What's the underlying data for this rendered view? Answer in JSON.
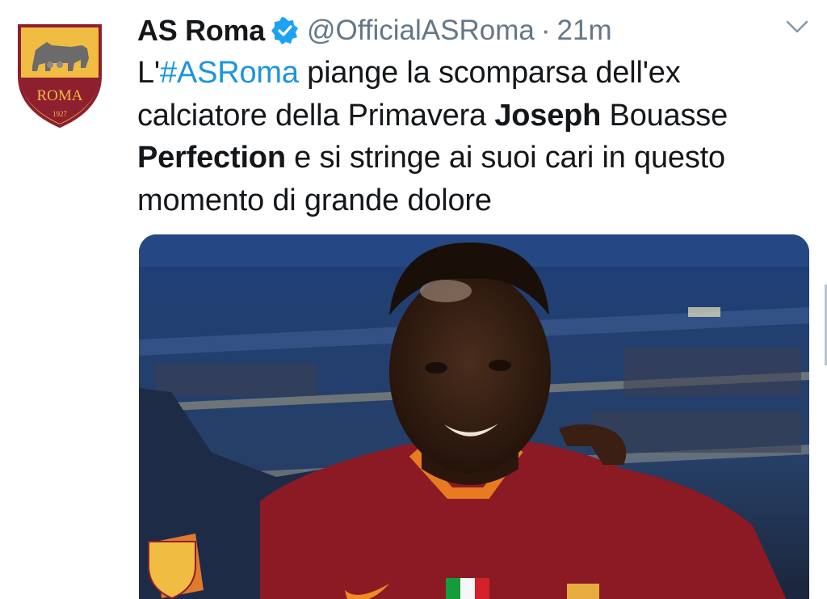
{
  "tweet": {
    "display_name": "AS Roma",
    "handle": "@OfficialASRoma",
    "separator": "·",
    "time": "21m",
    "text_parts": {
      "prefix": "L'",
      "hashtag": "#ASRoma",
      "t1": " piange la scomparsa dell'ex calciatore della Primavera ",
      "b1": "Joseph",
      "t2": " Bouasse ",
      "b2": "Perfection",
      "t3": " e si stringe ai suoi cari in questo momento di grande dolore"
    }
  },
  "avatar": {
    "badge_text": "ROMA",
    "badge_year": "1927"
  },
  "icons": {
    "verified": "verified-badge-icon",
    "chevron": "chevron-down-icon"
  },
  "colors": {
    "hashtag": "#1b95e0",
    "verified": "#1da1f2",
    "muted": "#657786",
    "roma_red": "#8e1f2f",
    "roma_gold": "#f0bc42"
  }
}
